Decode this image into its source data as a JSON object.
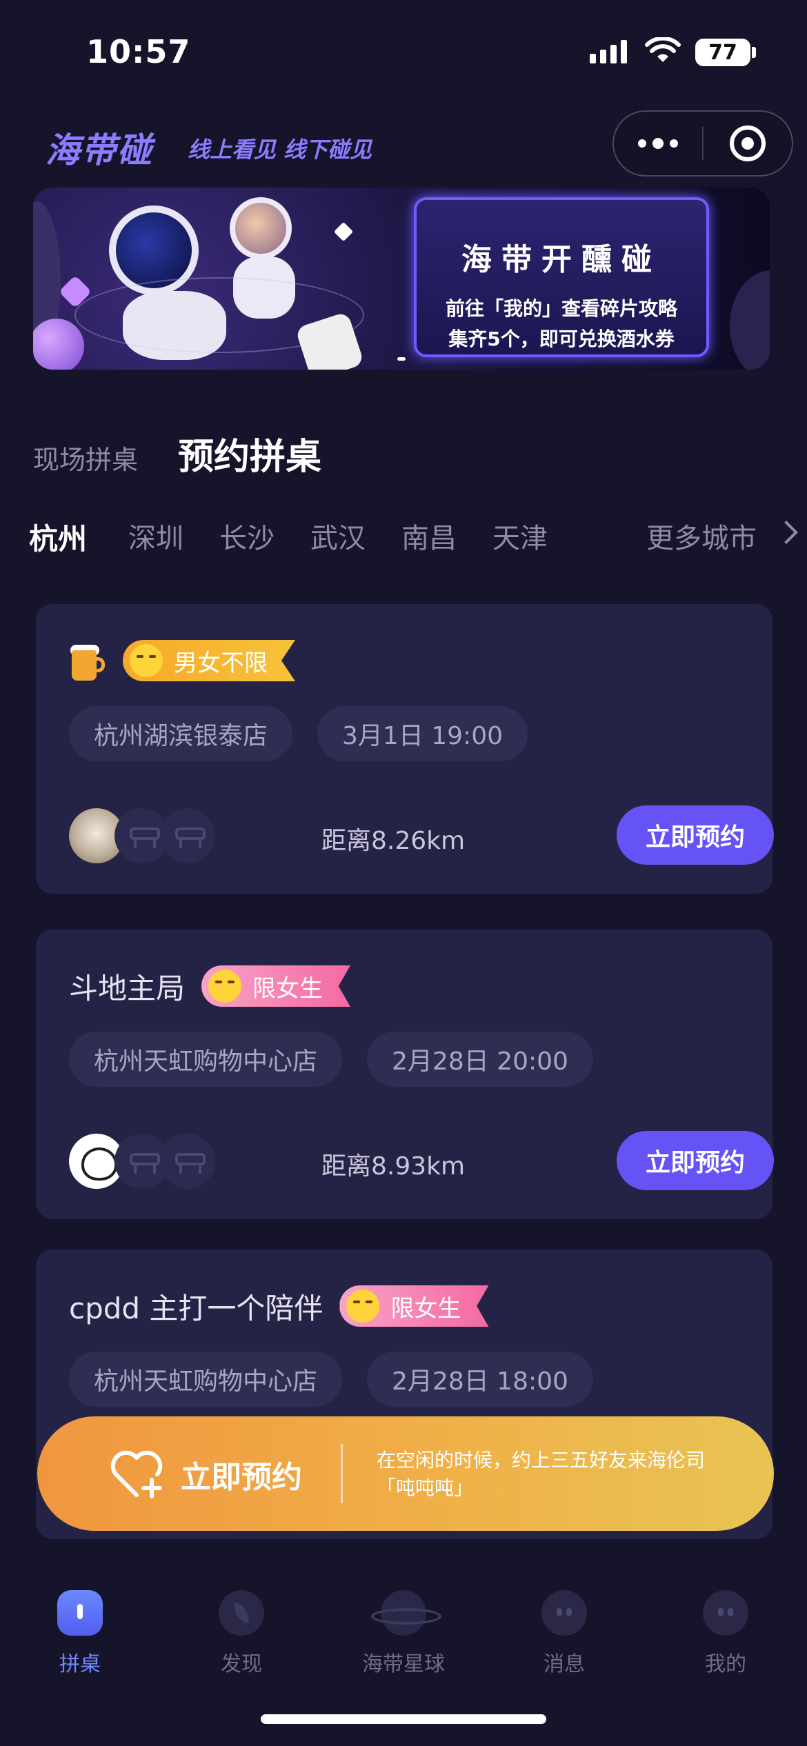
{
  "status_bar": {
    "time": "10:57",
    "battery": "77"
  },
  "header": {
    "logo": "海带碰",
    "slogan": "线上看见 线下碰见"
  },
  "banner": {
    "title": "海带开醺碰",
    "line1": "前往「我的」查看碎片攻略",
    "line2": "集齐5个，即可兑换酒水券"
  },
  "mode_tabs": [
    {
      "label": "现场拼桌",
      "active": false
    },
    {
      "label": "预约拼桌",
      "active": true
    }
  ],
  "cities": {
    "items": [
      "杭州",
      "深圳",
      "长沙",
      "武汉",
      "南昌",
      "天津"
    ],
    "active": "杭州",
    "more_label": "更多城市"
  },
  "cards": [
    {
      "title": "",
      "icon": "beer-icon",
      "badge": "男女不限",
      "badge_type": "any",
      "store": "杭州湖滨银泰店",
      "time": "3月1日 19:00",
      "distance": "距离8.26km",
      "button": "立即预约"
    },
    {
      "title": "斗地主局",
      "badge": "限女生",
      "badge_type": "female",
      "store": "杭州天虹购物中心店",
      "time": "2月28日 20:00",
      "distance": "距离8.93km",
      "button": "立即预约"
    },
    {
      "title": "cpdd 主打一个陪伴",
      "badge": "限女生",
      "badge_type": "female",
      "store": "杭州天虹购物中心店",
      "time": "2月28日 18:00"
    }
  ],
  "floating_cta": {
    "label": "立即预约",
    "description": "在空闲的时候，约上三五好友来海伦司「吨吨吨」"
  },
  "tabbar": [
    {
      "label": "拼桌",
      "icon": "table-icon",
      "active": true
    },
    {
      "label": "发现",
      "icon": "leaf-icon",
      "active": false
    },
    {
      "label": "海带星球",
      "icon": "planet-icon",
      "active": false
    },
    {
      "label": "消息",
      "icon": "message-icon",
      "active": false
    },
    {
      "label": "我的",
      "icon": "profile-icon",
      "active": false
    }
  ],
  "colors": {
    "background": "#16142a",
    "card": "#252345",
    "accent": "#6653f5",
    "brand": "#8d7cff",
    "cta_start": "#f0963f",
    "cta_end": "#e8c454"
  }
}
